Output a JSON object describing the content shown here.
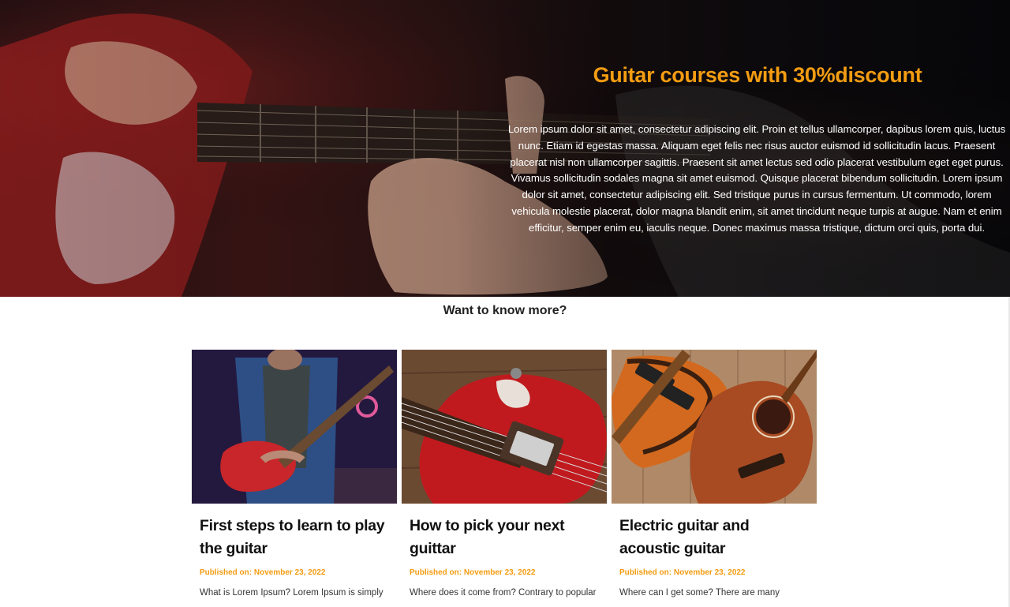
{
  "hero": {
    "title": "Guitar courses with 30%discount",
    "text": "Lorem ipsum dolor sit amet, consectetur adipiscing elit. Proin et tellus ullamcorper, dapibus lorem quis, luctus nunc. Etiam id egestas massa. Aliquam eget felis nec risus auctor euismod id sollicitudin lacus. Praesent placerat nisl non ullamcorper sagittis. Praesent sit amet lectus sed odio placerat vestibulum eget eget purus. Vivamus sollicitudin sodales magna sit amet euismod. Quisque placerat bibendum sollicitudin. Lorem ipsum dolor sit amet, consectetur adipiscing elit. Sed tristique purus in cursus fermentum. Ut commodo, lorem vehicula molestie placerat, dolor magna blandit enim, sit amet tincidunt neque turpis at augue. Nam et enim efficitur, semper enim eu, iaculis neque. Donec maximus massa tristique, dictum orci quis, porta dui."
  },
  "section": {
    "heading": "Want to know more?"
  },
  "cards": [
    {
      "title": "First steps to learn to play the guitar",
      "date": "Published on: November 23, 2022",
      "excerpt": "What is Lorem Ipsum? Lorem Ipsum is simply"
    },
    {
      "title": "How to pick your next guittar",
      "date": "Published on: November 23, 2022",
      "excerpt": "Where does it come from? Contrary to popular"
    },
    {
      "title": "Electric guitar and acoustic guitar",
      "date": "Published on: November 23, 2022",
      "excerpt": "Where can I get some? There are many"
    }
  ],
  "colors": {
    "accent": "#f39c12",
    "heading": "#222222"
  }
}
